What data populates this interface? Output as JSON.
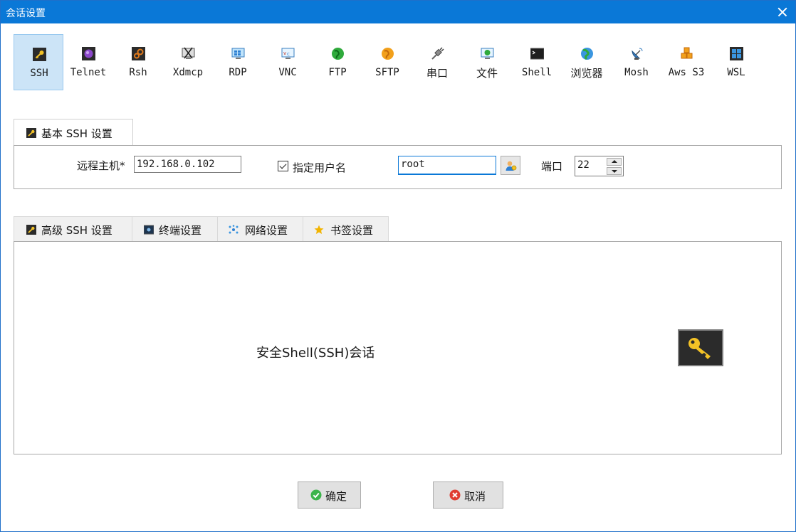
{
  "window": {
    "title": "会话设置"
  },
  "protocols": [
    {
      "id": "ssh",
      "label": "SSH",
      "icon": "key-icon",
      "active": true
    },
    {
      "id": "telnet",
      "label": "Telnet",
      "icon": "telnet-globe-icon"
    },
    {
      "id": "rsh",
      "label": "Rsh",
      "icon": "rsh-gears-icon"
    },
    {
      "id": "xdmcp",
      "label": "Xdmcp",
      "icon": "x-display-icon"
    },
    {
      "id": "rdp",
      "label": "RDP",
      "icon": "remote-desktop-icon"
    },
    {
      "id": "vnc",
      "label": "VNC",
      "icon": "vnc-monitor-icon"
    },
    {
      "id": "ftp",
      "label": "FTP",
      "icon": "ftp-globe-icon"
    },
    {
      "id": "sftp",
      "label": "SFTP",
      "icon": "sftp-globe-icon"
    },
    {
      "id": "serial",
      "label": "串口",
      "icon": "serial-plug-icon"
    },
    {
      "id": "file",
      "label": "文件",
      "icon": "file-monitor-icon"
    },
    {
      "id": "shell",
      "label": "Shell",
      "icon": "terminal-icon"
    },
    {
      "id": "browser",
      "label": "浏览器",
      "icon": "browser-globe-icon"
    },
    {
      "id": "mosh",
      "label": "Mosh",
      "icon": "satellite-dish-icon"
    },
    {
      "id": "awss3",
      "label": "Aws S3",
      "icon": "aws-cubes-icon"
    },
    {
      "id": "wsl",
      "label": "WSL",
      "icon": "windows-logo-icon"
    }
  ],
  "basic": {
    "tab_label": "基本 SSH 设置",
    "host_label": "远程主机*",
    "host_value": "192.168.0.102",
    "username_checkbox_label": "指定用户名",
    "username_checked": true,
    "username_value": "root",
    "port_label": "端口",
    "port_value": "22"
  },
  "advanced_tabs": [
    {
      "label": "高级 SSH 设置",
      "icon": "key-icon"
    },
    {
      "label": "终端设置",
      "icon": "terminal-settings-icon"
    },
    {
      "label": "网络设置",
      "icon": "network-icon"
    },
    {
      "label": "书签设置",
      "icon": "star-icon"
    }
  ],
  "description": "安全Shell(SSH)会话",
  "buttons": {
    "ok": "确定",
    "cancel": "取消"
  },
  "colors": {
    "titlebar": "#0a78d7",
    "active_tab_bg": "#cce4f7",
    "key": "#f3c226"
  }
}
